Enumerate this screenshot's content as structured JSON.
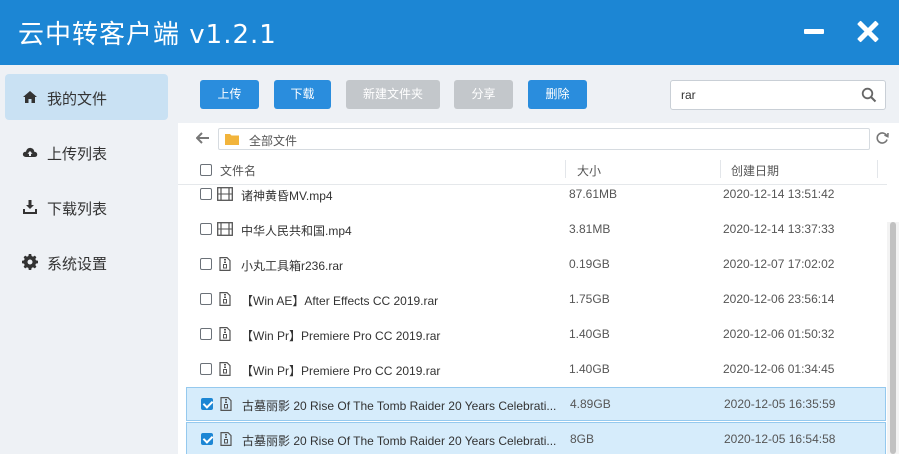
{
  "window": {
    "title": "云中转客户端 v1.2.1"
  },
  "sidebar": {
    "items": [
      {
        "label": "我的文件",
        "icon": "home-icon",
        "active": true
      },
      {
        "label": "上传列表",
        "icon": "cloud-upload-icon",
        "active": false
      },
      {
        "label": "下载列表",
        "icon": "download-icon",
        "active": false
      },
      {
        "label": "系统设置",
        "icon": "gear-icon",
        "active": false
      }
    ]
  },
  "toolbar": {
    "upload_label": "上传",
    "download_label": "下载",
    "new_folder_label": "新建文件夹",
    "share_label": "分享",
    "delete_label": "删除"
  },
  "search": {
    "value": "rar"
  },
  "path": {
    "label": "全部文件"
  },
  "table": {
    "headers": {
      "name": "文件名",
      "size": "大小",
      "date": "创建日期"
    },
    "rows": [
      {
        "name": "诸神黄昏MV.mp4",
        "size": "87.61MB",
        "date": "2020-12-14 13:51:42",
        "type": "video",
        "checked": false
      },
      {
        "name": "中华人民共和国.mp4",
        "size": "3.81MB",
        "date": "2020-12-14 13:37:33",
        "type": "video",
        "checked": false
      },
      {
        "name": "小丸工具箱r236.rar",
        "size": "0.19GB",
        "date": "2020-12-07 17:02:02",
        "type": "archive",
        "checked": false
      },
      {
        "name": "【Win AE】After Effects CC 2019.rar",
        "size": "1.75GB",
        "date": "2020-12-06 23:56:14",
        "type": "archive",
        "checked": false
      },
      {
        "name": "【Win Pr】Premiere Pro CC 2019.rar",
        "size": "1.40GB",
        "date": "2020-12-06 01:50:32",
        "type": "archive",
        "checked": false
      },
      {
        "name": "【Win Pr】Premiere Pro CC 2019.rar",
        "size": "1.40GB",
        "date": "2020-12-06 01:34:45",
        "type": "archive",
        "checked": false
      },
      {
        "name": "古墓丽影 20 Rise Of The Tomb Raider 20 Years Celebrati...",
        "size": "4.89GB",
        "date": "2020-12-05 16:35:59",
        "type": "archive",
        "checked": true
      },
      {
        "name": "古墓丽影 20 Rise Of The Tomb Raider 20 Years Celebrati...",
        "size": "8GB",
        "date": "2020-12-05 16:54:58",
        "type": "archive",
        "checked": true
      }
    ]
  },
  "colors": {
    "titlebar": "#1c86d4",
    "primary_button": "#2a8ddd",
    "disabled_button": "#c3c7cb",
    "selected_row": "#d6ecfb"
  }
}
